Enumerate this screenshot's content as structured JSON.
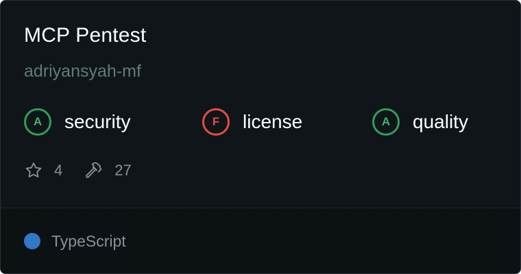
{
  "card": {
    "title": "MCP Pentest",
    "author": "adriyansyah-mf"
  },
  "scores": [
    {
      "grade": "A",
      "label": "security",
      "status": "good",
      "color": "#3fb56c"
    },
    {
      "grade": "F",
      "label": "license",
      "status": "bad",
      "color": "#e54a4a"
    },
    {
      "grade": "A",
      "label": "quality",
      "status": "good",
      "color": "#3fb56c"
    }
  ],
  "stats": {
    "stars": "4",
    "star_icon": "star-icon",
    "tools": "27",
    "tools_icon": "hammer-icon"
  },
  "language": {
    "name": "TypeScript",
    "color": "#3178c6"
  }
}
